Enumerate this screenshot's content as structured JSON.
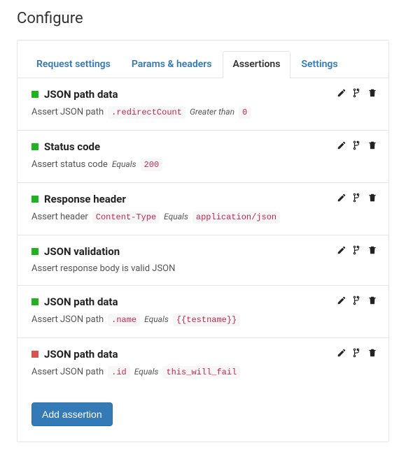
{
  "page_title": "Configure",
  "tabs": [
    {
      "label": "Request settings",
      "active": false
    },
    {
      "label": "Params & headers",
      "active": false
    },
    {
      "label": "Assertions",
      "active": true
    },
    {
      "label": "Settings",
      "active": false
    }
  ],
  "assertions": [
    {
      "status": "ok",
      "title": "JSON path data",
      "lead": "Assert JSON path",
      "parts": [
        {
          "kind": "code",
          "text": ".redirectCount"
        },
        {
          "kind": "op",
          "text": "Greater than"
        },
        {
          "kind": "code",
          "text": "0"
        }
      ]
    },
    {
      "status": "ok",
      "title": "Status code",
      "lead": "Assert status code",
      "parts": [
        {
          "kind": "op",
          "text": "Equals"
        },
        {
          "kind": "code",
          "text": "200"
        }
      ]
    },
    {
      "status": "ok",
      "title": "Response header",
      "lead": "Assert header",
      "parts": [
        {
          "kind": "code",
          "text": "Content-Type"
        },
        {
          "kind": "op",
          "text": "Equals"
        },
        {
          "kind": "code",
          "text": "application/json"
        }
      ]
    },
    {
      "status": "ok",
      "title": "JSON validation",
      "lead": "Assert response body is valid JSON",
      "parts": []
    },
    {
      "status": "ok",
      "title": "JSON path data",
      "lead": "Assert JSON path",
      "parts": [
        {
          "kind": "code",
          "text": ".name"
        },
        {
          "kind": "op",
          "text": "Equals"
        },
        {
          "kind": "code",
          "text": "{{testname}}"
        }
      ]
    },
    {
      "status": "fail",
      "title": "JSON path data",
      "lead": "Assert JSON path",
      "parts": [
        {
          "kind": "code",
          "text": ".id"
        },
        {
          "kind": "op",
          "text": "Equals"
        },
        {
          "kind": "code",
          "text": "this_will_fail"
        }
      ]
    }
  ],
  "add_button_label": "Add assertion",
  "icons": {
    "edit": "edit-icon",
    "branch": "branch-icon",
    "delete": "delete-icon"
  }
}
